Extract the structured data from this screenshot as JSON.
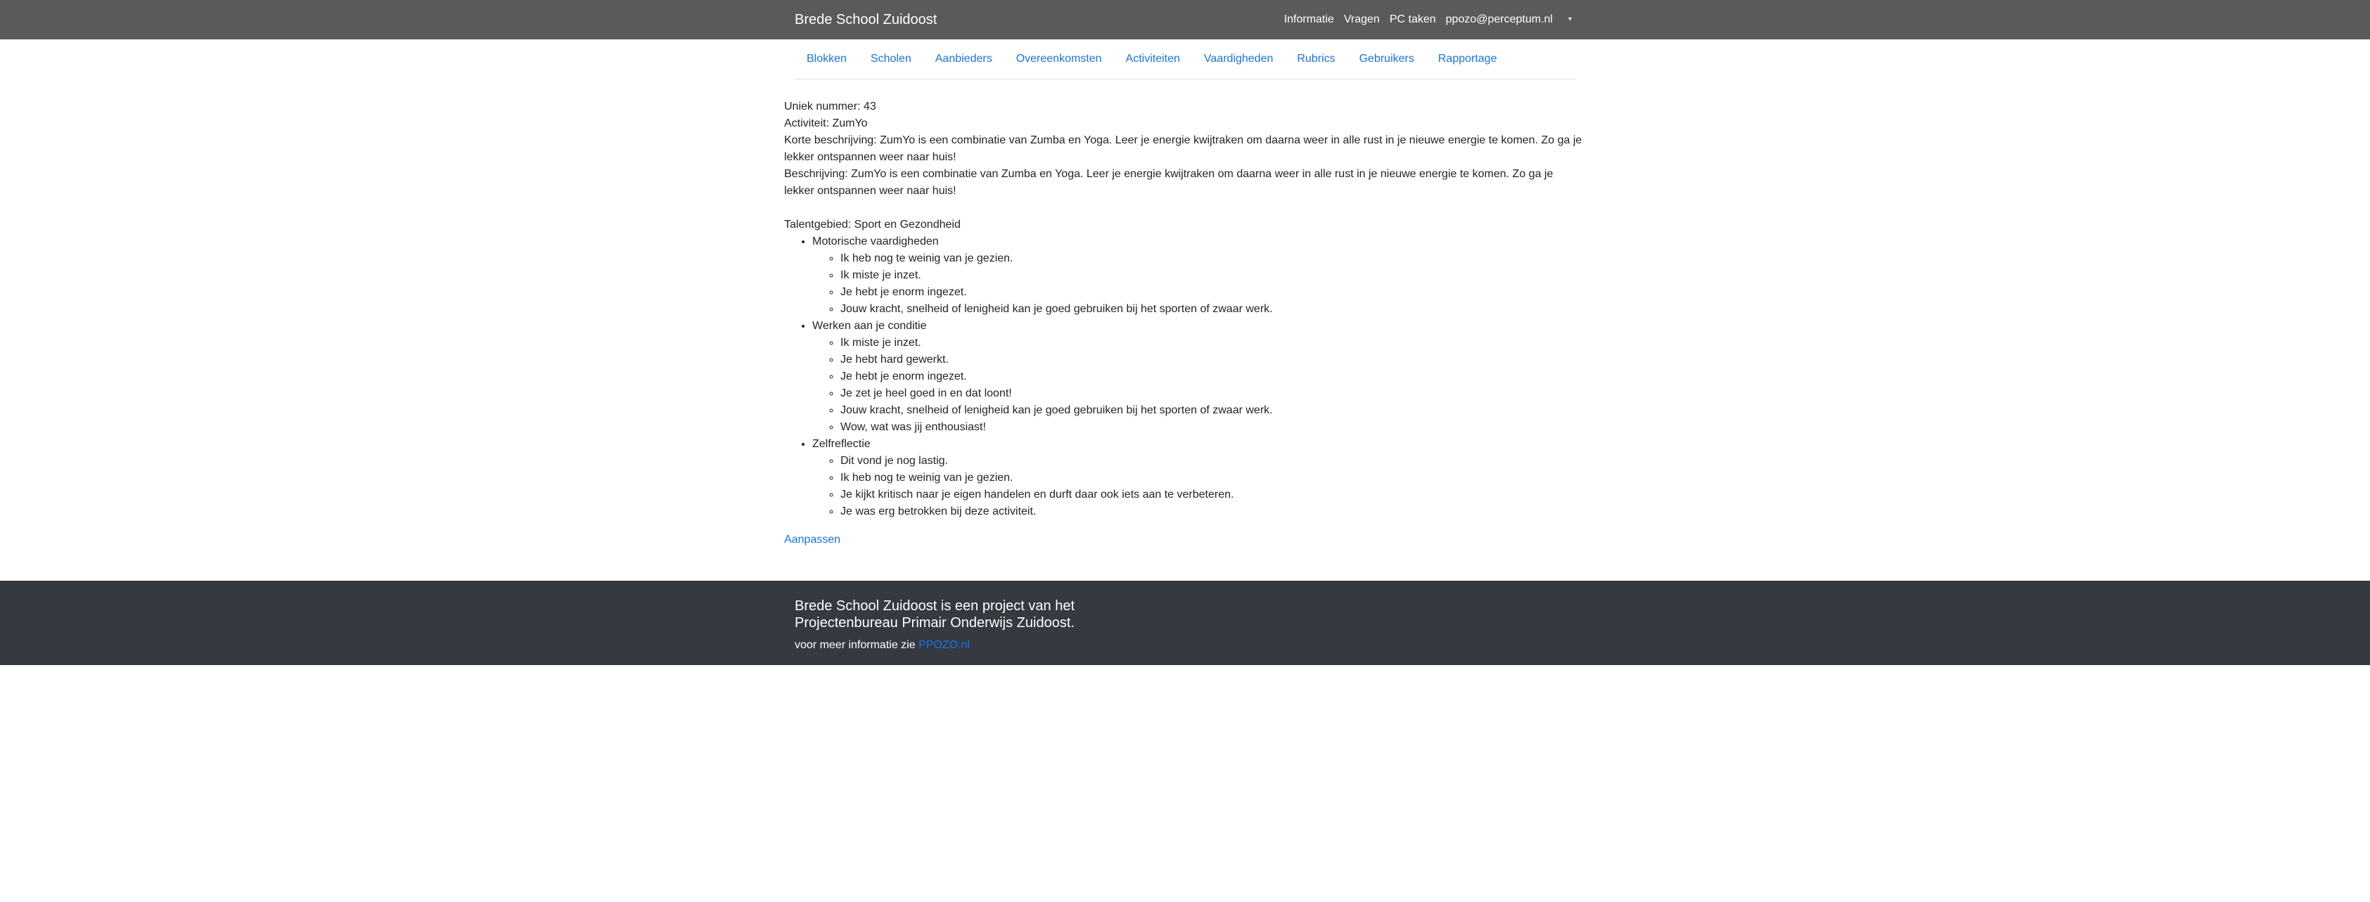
{
  "topbar": {
    "brand": "Brede School Zuidoost",
    "nav": [
      "Informatie",
      "Vragen",
      "PC taken",
      "ppozo@perceptum.nl"
    ],
    "caret": "▾"
  },
  "tabs": [
    "Blokken",
    "Scholen",
    "Aanbieders",
    "Overeenkomsten",
    "Activiteiten",
    "Vaardigheden",
    "Rubrics",
    "Gebruikers",
    "Rapportage"
  ],
  "detail": {
    "unique_number": "Uniek nummer: 43",
    "activity": "Activiteit: ZumYo",
    "short_description": "Korte beschrijving: ZumYo is een combinatie van Zumba en Yoga. Leer je energie kwijtraken om daarna weer in alle rust in je nieuwe energie te komen. Zo ga je lekker ontspannen weer naar huis!",
    "description": "Beschrijving: ZumYo is een combinatie van Zumba en Yoga. Leer je energie kwijtraken om daarna weer in alle rust in je nieuwe energie te komen. Zo ga je lekker ontspannen weer naar huis!",
    "talent_area": "Talentgebied: Sport en Gezondheid",
    "skills": [
      {
        "name": "Motorische vaardigheden",
        "items": [
          "Ik heb nog te weinig van je gezien.",
          "Ik miste je inzet.",
          "Je hebt je enorm ingezet.",
          "Jouw kracht, snelheid of lenigheid kan je goed gebruiken bij het sporten of zwaar werk."
        ]
      },
      {
        "name": "Werken aan je conditie",
        "items": [
          "Ik miste je inzet.",
          "Je hebt hard gewerkt.",
          "Je hebt je enorm ingezet.",
          "Je zet je heel goed in en dat loont!",
          "Jouw kracht, snelheid of lenigheid kan je goed gebruiken bij het sporten of zwaar werk.",
          "Wow, wat was jij enthousiast!"
        ]
      },
      {
        "name": "Zelfreflectie",
        "items": [
          "Dit vond je nog lastig.",
          "Ik heb nog te weinig van je gezien.",
          "Je kijkt kritisch naar je eigen handelen en durft daar ook iets aan te verbeteren.",
          "Je was erg betrokken bij deze activiteit."
        ]
      }
    ],
    "edit_link": "Aanpassen"
  },
  "footer": {
    "title": "Brede School Zuidoost is een project van het Projectenbureau Primair Onderwijs Zuidoost.",
    "info_prefix": "voor meer informatie zie",
    "info_link": "PPOZO.nl"
  },
  "colors": {
    "topbar": "#5a5a5a",
    "footer": "#343a40",
    "link": "#1a73e8"
  }
}
